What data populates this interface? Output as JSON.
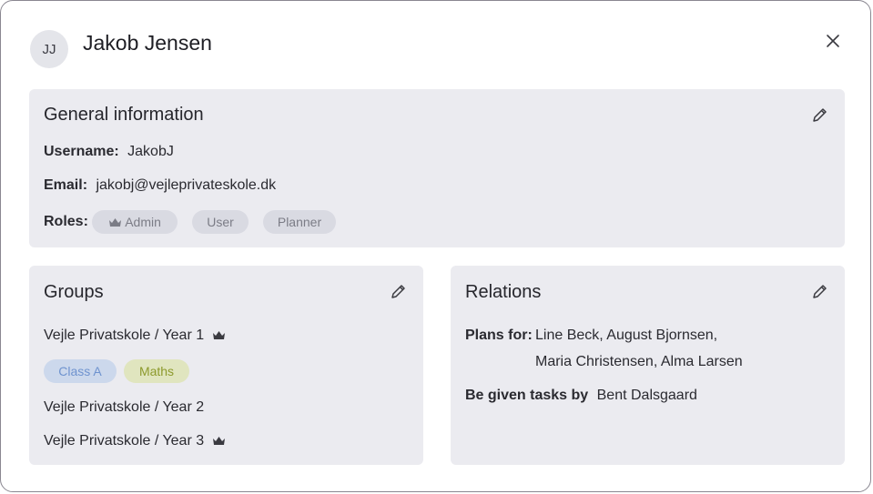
{
  "header": {
    "avatar_initials": "JJ",
    "name": "Jakob Jensen"
  },
  "general": {
    "title": "General information",
    "username_label": "Username:",
    "username_value": "JakobJ",
    "email_label": "Email:",
    "email_value": "jakobj@vejleprivateskole.dk",
    "roles_label": "Roles:",
    "roles": [
      "Admin",
      "User",
      "Planner"
    ]
  },
  "groups": {
    "title": "Groups",
    "items": [
      "Vejle Privatskole / Year 1",
      "Vejle Privatskole / Year 2",
      "Vejle Privatskole / Year 3"
    ],
    "tags": [
      "Class A",
      "Maths"
    ]
  },
  "relations": {
    "title": "Relations",
    "plans_for_label": "Plans for:",
    "plans_for_line1": "Line Beck,  August Bjornsen,",
    "plans_for_line2": "Maria Christensen,  Alma Larsen",
    "tasks_label": "Be given tasks by",
    "tasks_value": "Bent Dalsgaard"
  },
  "colors": {
    "card_bg": "#ebebf0",
    "role_chip": "#d9dae2",
    "class_chip": "#ccd8ec",
    "maths_chip": "#e0e5bf"
  },
  "icons": [
    "close-icon",
    "pencil-icon",
    "crown-icon"
  ]
}
